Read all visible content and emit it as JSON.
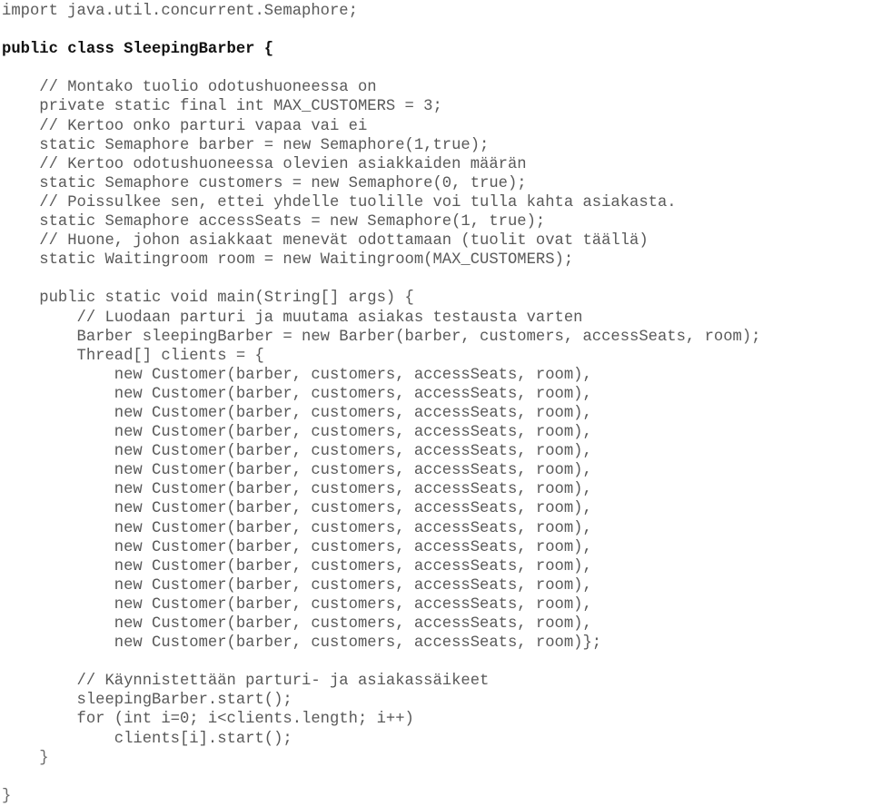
{
  "document": {
    "kind": "source-code-listing",
    "language": "Java",
    "class_name": "SleepingBarber",
    "text_color": "#595959",
    "emphasis_color": "#111111",
    "background_color": "#ffffff"
  },
  "code": {
    "lines": [
      {
        "text": "import java.util.concurrent.Semaphore;",
        "style": "plain"
      },
      {
        "text": "",
        "style": "blank"
      },
      {
        "text": "public class SleepingBarber {",
        "style": "bold"
      },
      {
        "text": "",
        "style": "blank"
      },
      {
        "text": "    // Montako tuolio odotushuoneessa on",
        "style": "plain"
      },
      {
        "text": "    private static final int MAX_CUSTOMERS = 3;",
        "style": "plain"
      },
      {
        "text": "    // Kertoo onko parturi vapaa vai ei",
        "style": "plain"
      },
      {
        "text": "    static Semaphore barber = new Semaphore(1,true);",
        "style": "plain"
      },
      {
        "text": "    // Kertoo odotushuoneessa olevien asiakkaiden määrän",
        "style": "plain"
      },
      {
        "text": "    static Semaphore customers = new Semaphore(0, true);",
        "style": "plain"
      },
      {
        "text": "    // Poissulkee sen, ettei yhdelle tuolille voi tulla kahta asiakasta.",
        "style": "plain"
      },
      {
        "text": "    static Semaphore accessSeats = new Semaphore(1, true);",
        "style": "plain"
      },
      {
        "text": "    // Huone, johon asiakkaat menevät odottamaan (tuolit ovat täällä)",
        "style": "plain"
      },
      {
        "text": "    static Waitingroom room = new Waitingroom(MAX_CUSTOMERS);",
        "style": "plain"
      },
      {
        "text": "",
        "style": "blank"
      },
      {
        "text": "    public static void main(String[] args) {",
        "style": "plain"
      },
      {
        "text": "        // Luodaan parturi ja muutama asiakas testausta varten",
        "style": "plain"
      },
      {
        "text": "        Barber sleepingBarber = new Barber(barber, customers, accessSeats, room);",
        "style": "plain"
      },
      {
        "text": "        Thread[] clients = {",
        "style": "plain"
      },
      {
        "text": "            new Customer(barber, customers, accessSeats, room),",
        "style": "plain"
      },
      {
        "text": "            new Customer(barber, customers, accessSeats, room),",
        "style": "plain"
      },
      {
        "text": "            new Customer(barber, customers, accessSeats, room),",
        "style": "plain"
      },
      {
        "text": "            new Customer(barber, customers, accessSeats, room),",
        "style": "plain"
      },
      {
        "text": "            new Customer(barber, customers, accessSeats, room),",
        "style": "plain"
      },
      {
        "text": "            new Customer(barber, customers, accessSeats, room),",
        "style": "plain"
      },
      {
        "text": "            new Customer(barber, customers, accessSeats, room),",
        "style": "plain"
      },
      {
        "text": "            new Customer(barber, customers, accessSeats, room),",
        "style": "plain"
      },
      {
        "text": "            new Customer(barber, customers, accessSeats, room),",
        "style": "plain"
      },
      {
        "text": "            new Customer(barber, customers, accessSeats, room),",
        "style": "plain"
      },
      {
        "text": "            new Customer(barber, customers, accessSeats, room),",
        "style": "plain"
      },
      {
        "text": "            new Customer(barber, customers, accessSeats, room),",
        "style": "plain"
      },
      {
        "text": "            new Customer(barber, customers, accessSeats, room),",
        "style": "plain"
      },
      {
        "text": "            new Customer(barber, customers, accessSeats, room),",
        "style": "plain"
      },
      {
        "text": "            new Customer(barber, customers, accessSeats, room)};",
        "style": "plain"
      },
      {
        "text": "",
        "style": "blank"
      },
      {
        "text": "        // Käynnistettään parturi- ja asiakassäikeet",
        "style": "plain"
      },
      {
        "text": "        sleepingBarber.start();",
        "style": "plain"
      },
      {
        "text": "        for (int i=0; i<clients.length; i++)",
        "style": "plain"
      },
      {
        "text": "            clients[i].start();",
        "style": "plain"
      },
      {
        "text": "    }",
        "style": "brace"
      },
      {
        "text": "",
        "style": "blank"
      },
      {
        "text": "}",
        "style": "brace"
      }
    ]
  }
}
